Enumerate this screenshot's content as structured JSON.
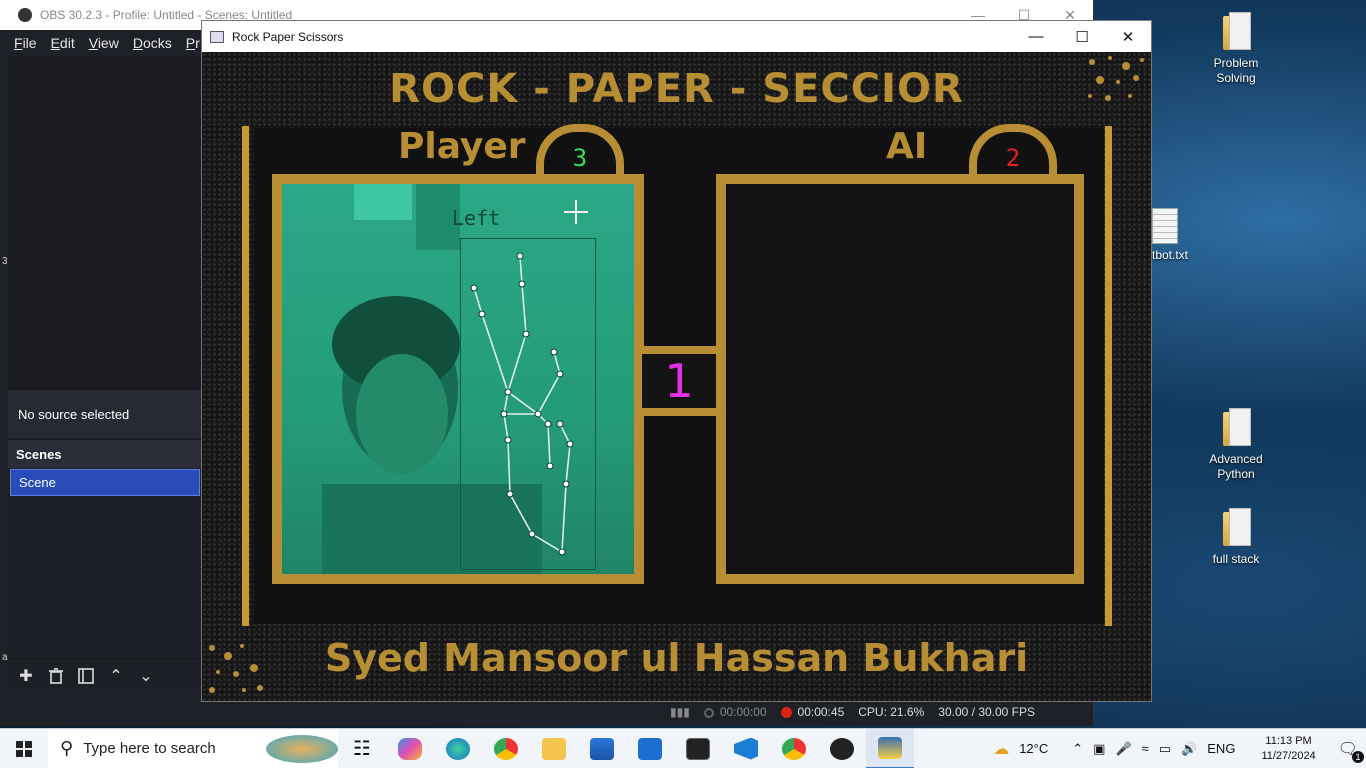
{
  "obs": {
    "title": "OBS 30.2.3 - Profile: Untitled - Scenes: Untitled",
    "menu": [
      "File",
      "Edit",
      "View",
      "Docks",
      "Pr"
    ],
    "no_source": "No source selected",
    "scenes_header": "Scenes",
    "scenes": [
      "Scene"
    ],
    "status": {
      "stream_time": "00:00:00",
      "rec_time": "00:00:45",
      "cpu": "CPU: 21.6%",
      "fps": "30.00 / 30.00 FPS"
    },
    "window_controls": [
      "minimize-icon",
      "maximize-icon",
      "close-icon"
    ]
  },
  "game": {
    "window_title": "Rock Paper Scissors",
    "title": "ROCK - PAPER - SECCIOR",
    "player_label": "Player",
    "ai_label": "AI",
    "player_score": "3",
    "ai_score": "2",
    "round": "1",
    "hand_label": "Left",
    "footer": "Syed Mansoor ul Hassan Bukhari",
    "colors": {
      "gold": "#b78e33",
      "player_score": "#2fe05a",
      "ai_score": "#e32020",
      "round": "#e62ee6",
      "camera_tint": "#2ba886"
    }
  },
  "desktop": {
    "icons": [
      {
        "label": "Problem Solving",
        "icon": "folder-icon"
      },
      {
        "label": "tbot.txt",
        "icon": "text-file-icon"
      },
      {
        "label": "Advanced Python",
        "icon": "folder-icon"
      },
      {
        "label": "full stack",
        "icon": "folder-icon"
      }
    ]
  },
  "taskbar": {
    "search_placeholder": "Type here to search",
    "weather": "12°C",
    "lang": "ENG",
    "time": "11:13 PM",
    "date": "11/27/2024",
    "notification_count": "1",
    "apps": [
      "task-view-icon",
      "copilot-icon",
      "edge-icon",
      "chrome-icon",
      "file-explorer-icon",
      "store-icon",
      "mail-icon",
      "terminal-icon",
      "vscode-icon",
      "chrome-profile-icon",
      "obs-icon",
      "python-app-icon"
    ]
  }
}
